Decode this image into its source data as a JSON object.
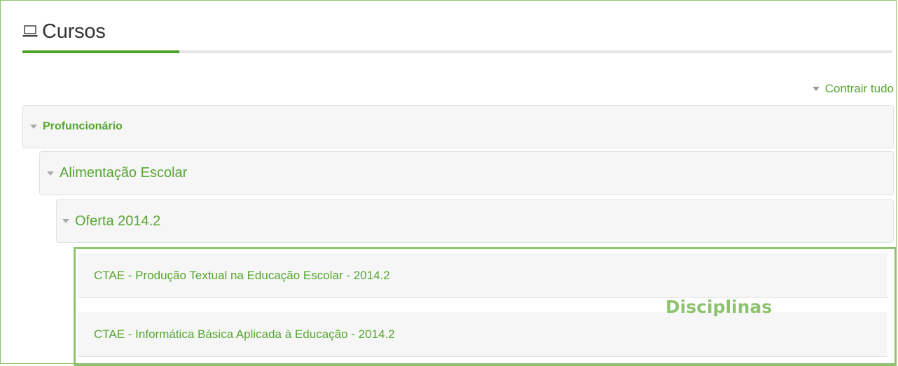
{
  "header": {
    "title": "Cursos",
    "icon": "laptop-icon"
  },
  "toolbar": {
    "collapse_all_label": "Contrair tudo"
  },
  "categories": {
    "level1": {
      "label": "Profuncionário",
      "icon": "triangle-down-icon"
    },
    "level2": {
      "label": "Alimentação Escolar",
      "icon": "triangle-down-icon"
    },
    "level3": {
      "label": "Oferta 2014.2",
      "icon": "triangle-down-icon"
    }
  },
  "courses": [
    {
      "label": "CTAE - Produção Textual na Educação Escolar - 2014.2"
    },
    {
      "label": "CTAE - Informática Básica Aplicada à Educação - 2014.2"
    }
  ],
  "annotation": {
    "label": "Disciplinas"
  },
  "colors": {
    "accent_green": "#55a630",
    "highlight_green": "#8dc26f",
    "underline_green": "#4ea127"
  }
}
